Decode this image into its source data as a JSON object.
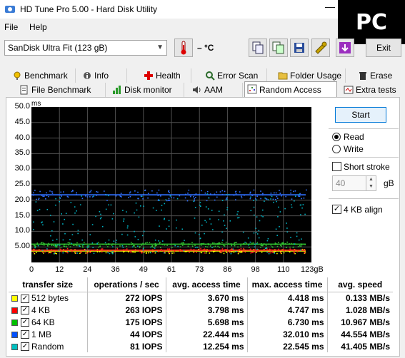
{
  "window": {
    "title": "HD Tune Pro 5.00 - Hard Disk Utility",
    "minimize_glyph": "—",
    "badge": "PC"
  },
  "menu": [
    {
      "label": "File"
    },
    {
      "label": "Help"
    }
  ],
  "toolbar": {
    "drive": "SanDisk Ultra Fit (123 gB)",
    "temperature": "– °C",
    "exit_label": "Exit",
    "icons": [
      "copy-text-icon",
      "copy-screenshot-icon",
      "save-icon",
      "options-icon",
      "download-icon"
    ]
  },
  "tabs_row1": [
    {
      "label": "Benchmark",
      "icon": "benchmark-icon"
    },
    {
      "label": "Info",
      "icon": "info-icon"
    },
    {
      "label": "Health",
      "icon": "health-icon"
    },
    {
      "label": "Error Scan",
      "icon": "error-scan-icon"
    },
    {
      "label": "Folder Usage",
      "icon": "folder-icon"
    },
    {
      "label": "Erase",
      "icon": "trash-icon"
    }
  ],
  "tabs_row2": [
    {
      "label": "File Benchmark",
      "icon": "file-benchmark-icon"
    },
    {
      "label": "Disk monitor",
      "icon": "disk-monitor-icon"
    },
    {
      "label": "AAM",
      "icon": "speaker-icon"
    },
    {
      "label": "Random Access",
      "icon": "random-access-icon",
      "active": true
    },
    {
      "label": "Extra tests",
      "icon": "extra-tests-icon"
    }
  ],
  "controls": {
    "start_label": "Start",
    "read_label": "Read",
    "write_label": "Write",
    "mode": "Read",
    "short_stroke_label": "Short stroke",
    "short_stroke_checked": false,
    "short_stroke_value": "40",
    "short_stroke_unit": "gB",
    "align_label": "4 KB align",
    "align_checked": true
  },
  "chart_data": {
    "type": "scatter",
    "ylabel": "ms",
    "ylim": [
      0,
      50
    ],
    "yticks": [
      "50.0",
      "45.0",
      "40.0",
      "35.0",
      "30.0",
      "25.0",
      "20.0",
      "15.0",
      "10.0",
      "5.00"
    ],
    "xticks": [
      "0",
      "12",
      "24",
      "36",
      "49",
      "61",
      "73",
      "86",
      "98",
      "110",
      "123gB"
    ],
    "xlim": [
      0,
      123
    ],
    "background": "#000000",
    "grid_color": "#505050",
    "series": [
      {
        "name": "512 bytes",
        "color": "#ffff00",
        "band": [
          3.0,
          4.4
        ]
      },
      {
        "name": "4 KB",
        "color": "#ff2020",
        "band": [
          3.2,
          4.7
        ]
      },
      {
        "name": "64 KB",
        "color": "#30c030",
        "band": [
          5.0,
          6.7
        ]
      },
      {
        "name": "1 MB",
        "color": "#3070ff",
        "band": [
          20.0,
          23.5
        ]
      },
      {
        "name": "Random",
        "color": "#00b0c0",
        "band": [
          3.0,
          22.5
        ]
      }
    ]
  },
  "results": {
    "headers": [
      "transfer size",
      "operations / sec",
      "avg. access time",
      "max. access time",
      "avg. speed"
    ],
    "rows": [
      {
        "size": "512 bytes",
        "color": "#ffff00",
        "ops": "272 IOPS",
        "avg": "3.670 ms",
        "max": "4.418 ms",
        "speed": "0.133 MB/s"
      },
      {
        "size": "4 KB",
        "color": "#ff0000",
        "ops": "263 IOPS",
        "avg": "3.798 ms",
        "max": "4.747 ms",
        "speed": "1.028 MB/s"
      },
      {
        "size": "64 KB",
        "color": "#00c000",
        "ops": "175 IOPS",
        "avg": "5.698 ms",
        "max": "6.730 ms",
        "speed": "10.967 MB/s"
      },
      {
        "size": "1 MB",
        "color": "#0050ff",
        "ops": "44 IOPS",
        "avg": "22.444 ms",
        "max": "32.010 ms",
        "speed": "44.554 MB/s"
      },
      {
        "size": "Random",
        "color": "#00c0c0",
        "ops": "81 IOPS",
        "avg": "12.254 ms",
        "max": "22.545 ms",
        "speed": "41.405 MB/s"
      }
    ]
  }
}
